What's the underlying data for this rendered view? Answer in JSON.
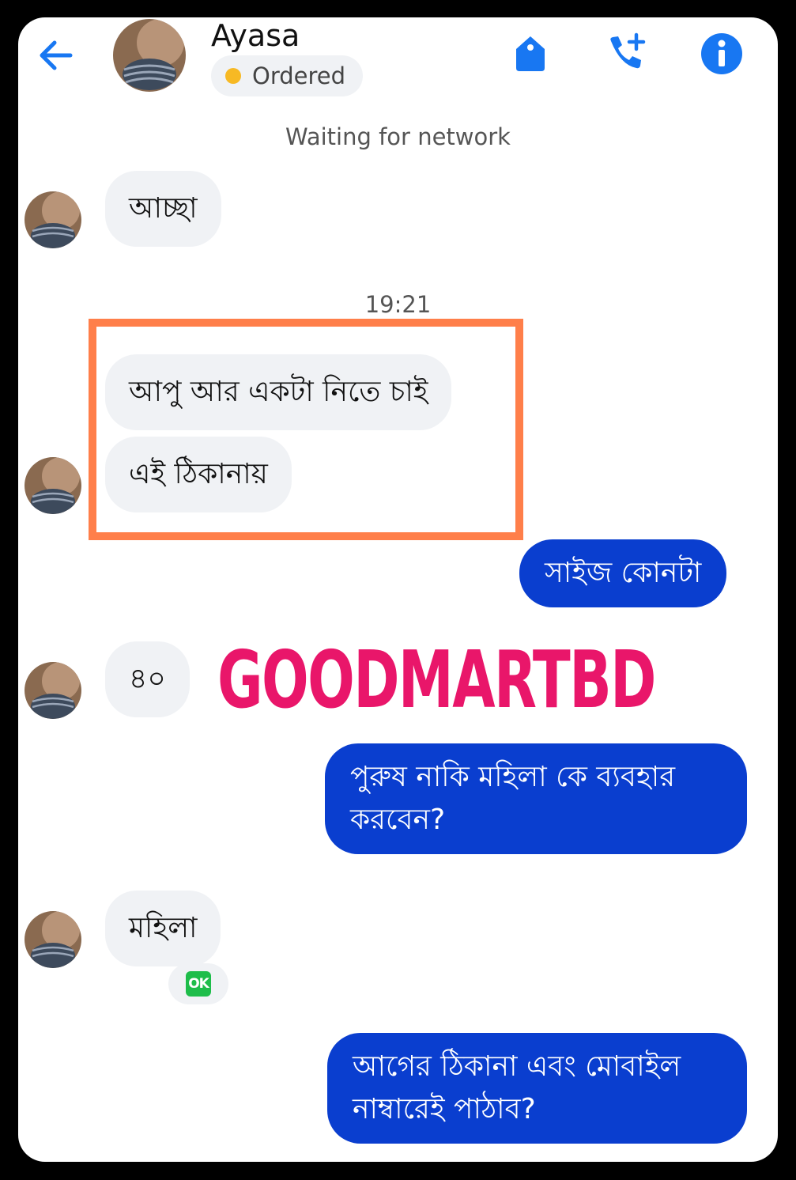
{
  "header": {
    "contact_name": "Ayasa",
    "status_label": "Ordered",
    "status_color": "#f7b924",
    "icons": [
      "back-arrow-icon",
      "tag-icon",
      "add-call-icon",
      "info-icon"
    ],
    "accent_color": "#1877f2"
  },
  "network_status": "Waiting for network",
  "timestamp": "19:21",
  "messages": [
    {
      "from": "contact",
      "text": "আচ্ছা"
    },
    {
      "from": "contact",
      "text": "আপু আর একটা নিতে চাই"
    },
    {
      "from": "contact",
      "text": "এই ঠিকানায়"
    },
    {
      "from": "me",
      "text": "সাইজ কোনটা"
    },
    {
      "from": "contact",
      "text": "৪০"
    },
    {
      "from": "me",
      "text": "পুরুষ নাকি মহিলা কে ব্যবহার করবেন?"
    },
    {
      "from": "contact",
      "text": "মহিলা",
      "reaction": "OK"
    },
    {
      "from": "me",
      "text": "আগের ঠিকানা এবং মোবাইল নাম্বারেই পাঠাব?"
    }
  ],
  "watermark": "GOODMARTBD",
  "colors": {
    "outgoing_bubble": "#0a3ecf",
    "incoming_bubble": "#f0f2f5",
    "highlight_border": "#ff7f4a",
    "watermark": "#e9166a"
  }
}
